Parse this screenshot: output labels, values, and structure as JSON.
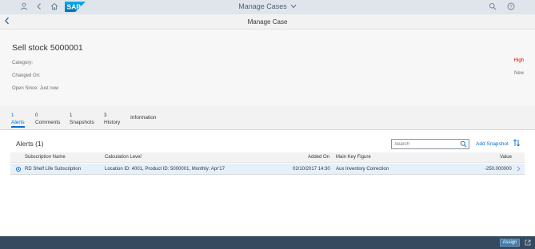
{
  "shell": {
    "title": "Manage Cases",
    "logo_text": "SAP",
    "icons": [
      "person-icon",
      "back-icon",
      "home-icon",
      "search-icon",
      "help-icon"
    ]
  },
  "page": {
    "title": "Manage Case"
  },
  "object": {
    "title": "Sell stock 5000001",
    "category_label": "Category:",
    "changed_label": "Changed On:",
    "open_since": "Open Since: Just now",
    "priority": "High",
    "status": "New"
  },
  "tabs": [
    {
      "count": "1",
      "label": "Alerts"
    },
    {
      "count": "0",
      "label": "Comments"
    },
    {
      "count": "1",
      "label": "Snapshots"
    },
    {
      "count": "3",
      "label": "History"
    },
    {
      "count": "",
      "label": "Information"
    }
  ],
  "alerts": {
    "title": "Alerts (1)",
    "search_placeholder": "Search",
    "add_snapshot": "Add Snapshot",
    "columns": [
      "Subscription Name",
      "Calculation Level",
      "Added On",
      "Main Key Figure",
      "Value"
    ],
    "rows": [
      {
        "subscription": "RD Shelf Life Subscription",
        "calc_level": "Location ID: 4001, Product ID: 5000001, Monthly: Apr'17",
        "added_on": "02/10/2017 14:30",
        "key_figure": "Aux Inventory Correction",
        "value": "-250.000000"
      }
    ]
  },
  "footer": {
    "assign": "Assign"
  },
  "colors": {
    "accent": "#0a6ed1",
    "priority_high": "#e50000",
    "footer_bg": "#354a5f",
    "shell_bg": "#dfe5eb"
  }
}
